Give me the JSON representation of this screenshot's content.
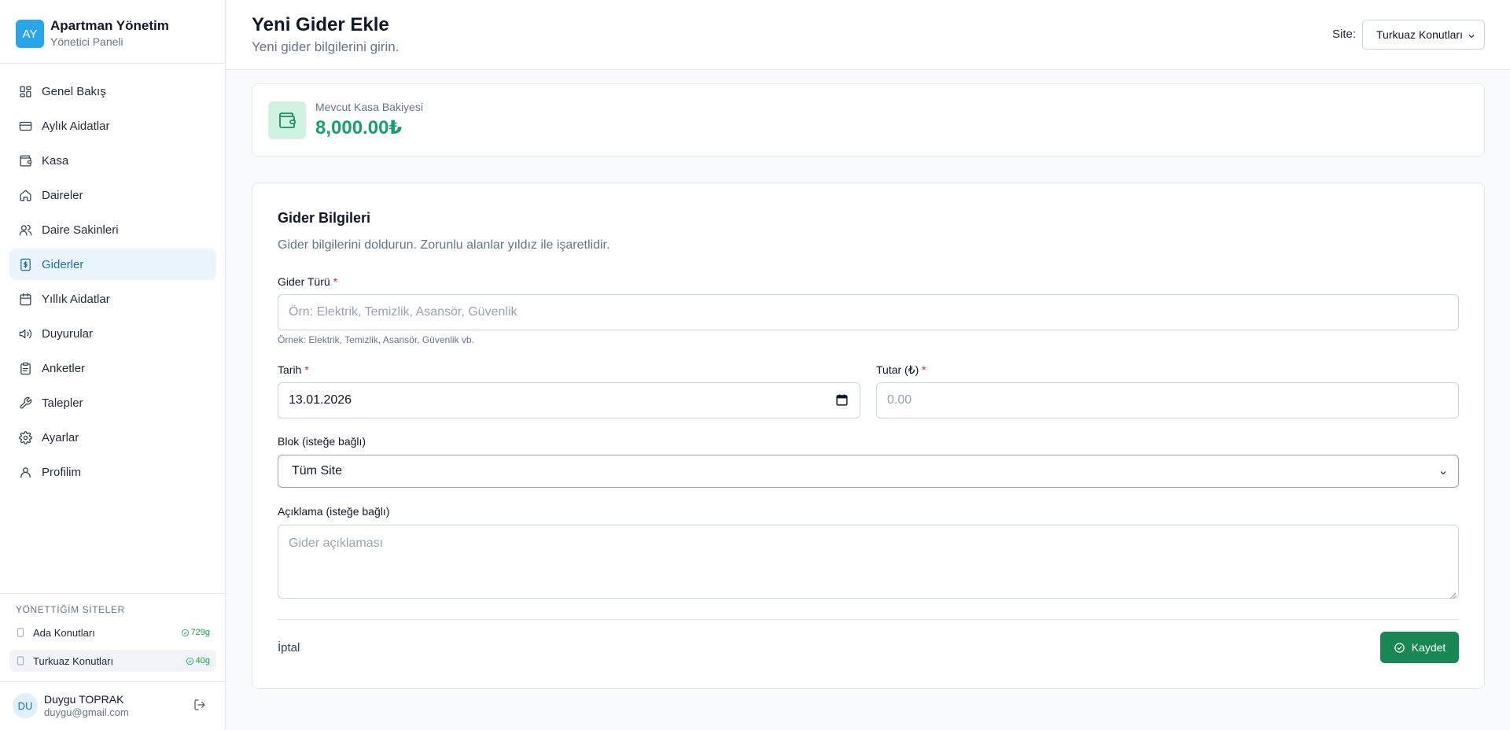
{
  "brand": {
    "logo_initials": "AY",
    "title": "Apartman Yönetim",
    "subtitle": "Yönetici Paneli"
  },
  "sidebar": {
    "items": [
      {
        "label": "Genel Bakış",
        "icon": "dashboard-grid-icon",
        "active": false
      },
      {
        "label": "Aylık Aidatlar",
        "icon": "credit-card-icon",
        "active": false
      },
      {
        "label": "Kasa",
        "icon": "wallet-icon",
        "active": false
      },
      {
        "label": "Daireler",
        "icon": "home-icon",
        "active": false
      },
      {
        "label": "Daire Sakinleri",
        "icon": "users-icon",
        "active": false
      },
      {
        "label": "Giderler",
        "icon": "receipt-dollar-icon",
        "active": true
      },
      {
        "label": "Yıllık Aidatlar",
        "icon": "calendar-icon",
        "active": false
      },
      {
        "label": "Duyurular",
        "icon": "megaphone-icon",
        "active": false
      },
      {
        "label": "Anketler",
        "icon": "clipboard-icon",
        "active": false
      },
      {
        "label": "Talepler",
        "icon": "wrench-icon",
        "active": false
      },
      {
        "label": "Ayarlar",
        "icon": "gear-icon",
        "active": false
      },
      {
        "label": "Profilim",
        "icon": "user-icon",
        "active": false
      }
    ],
    "sites_title": "YÖNETTİĞİM SİTELER",
    "sites": [
      {
        "name": "Ada Konutları",
        "badge": "729g",
        "active": false
      },
      {
        "name": "Turkuaz Konutları",
        "badge": "40g",
        "active": true
      }
    ],
    "user": {
      "initials": "DU",
      "name": "Duygu TOPRAK",
      "email": "duygu@gmail.com"
    }
  },
  "header": {
    "title": "Yeni Gider Ekle",
    "subtitle": "Yeni gider bilgilerini girin.",
    "site_label": "Site:",
    "site_selected": "Turkuaz Konutları"
  },
  "balance": {
    "label": "Mevcut Kasa Bakiyesi",
    "value": "8,000.00₺"
  },
  "form": {
    "title": "Gider Bilgileri",
    "description": "Gider bilgilerini doldurun. Zorunlu alanlar yıldız ile işaretlidir.",
    "type_label": "Gider Türü",
    "type_placeholder": "Örn: Elektrik, Temizlik, Asansör, Güvenlik",
    "type_hint": "Örnek: Elektrik, Temizlik, Asansör, Güvenlik vb.",
    "date_label": "Tarih",
    "date_value": "13.01.2026",
    "amount_label": "Tutar (₺)",
    "amount_placeholder": "0.00",
    "block_label": "Blok (isteğe bağlı)",
    "block_selected": "Tüm Site",
    "desc_label": "Açıklama (isteğe bağlı)",
    "desc_placeholder": "Gider açıklaması",
    "required_mark": "*",
    "cancel_label": "İptal",
    "save_label": "Kaydet"
  },
  "colors": {
    "accent": "#2ba5ea",
    "active_bg": "#eaf4fd",
    "success": "#198754",
    "balance_text": "#16a16b",
    "required": "#dc2626"
  }
}
